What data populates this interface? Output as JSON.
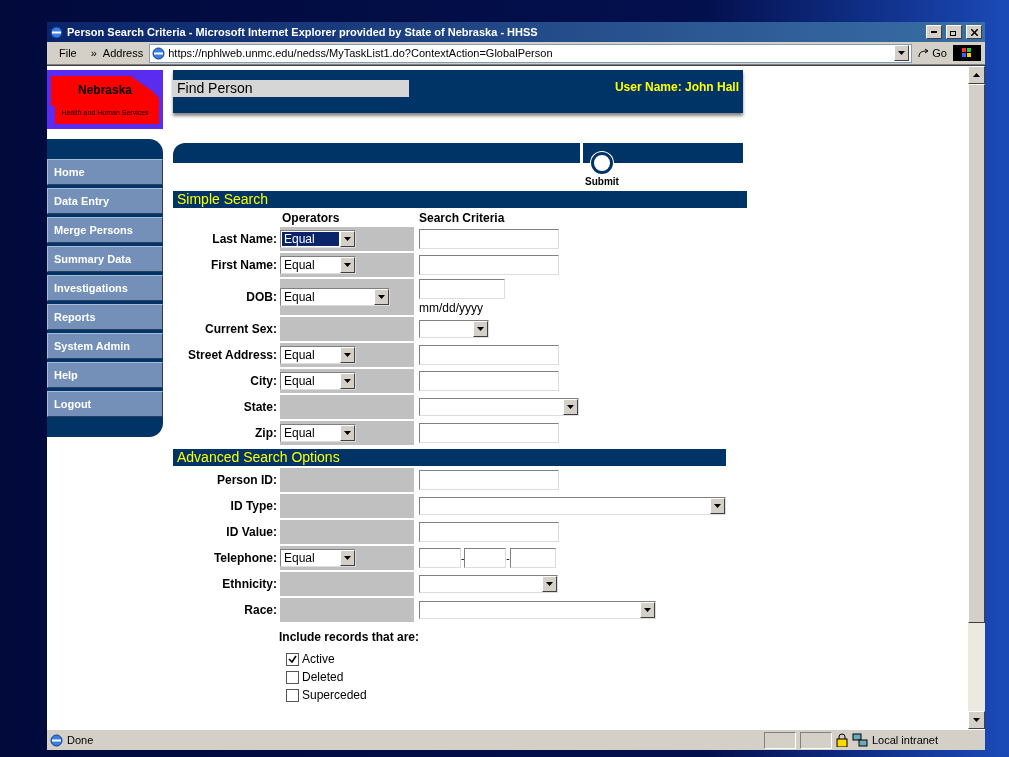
{
  "window": {
    "title": "Person Search Criteria - Microsoft Internet Explorer provided by State of Nebraska - HHSS"
  },
  "toolbar": {
    "menu": "File",
    "chevron": "»",
    "address_label": "Address",
    "url": "https://nphlweb.unmc.edu/nedss/MyTaskList1.do?ContextAction=GlobalPerson",
    "go": "Go"
  },
  "logo": {
    "title": "Nebraska",
    "subtitle": "Health and Human Services"
  },
  "sidebar": {
    "items": [
      {
        "label": "Home"
      },
      {
        "label": "Data Entry"
      },
      {
        "label": "Merge Persons"
      },
      {
        "label": "Summary Data"
      },
      {
        "label": "Investigations"
      },
      {
        "label": "Reports"
      },
      {
        "label": "System Admin"
      },
      {
        "label": "Help"
      },
      {
        "label": "Logout"
      }
    ]
  },
  "header": {
    "title": "Find Person",
    "user": "User Name: John Hall"
  },
  "submit": {
    "label": "Submit"
  },
  "simple_search": {
    "title": "Simple Search",
    "col_operators": "Operators",
    "col_criteria": "Search Criteria",
    "rows": [
      {
        "label": "Last Name:",
        "operator": {
          "value": "Equal",
          "focused": true
        },
        "kind": "text"
      },
      {
        "label": "First Name:",
        "operator": {
          "value": "Equal",
          "focused": false
        },
        "kind": "text"
      },
      {
        "label": "DOB:",
        "operator": {
          "value": "Equal",
          "focused": false
        },
        "kind": "date",
        "hint": "mm/dd/yyyy"
      },
      {
        "label": "Current Sex:",
        "kind": "select-small"
      },
      {
        "label": "Street Address:",
        "operator": {
          "value": "Equal",
          "focused": false
        },
        "kind": "text"
      },
      {
        "label": "City:",
        "operator": {
          "value": "Equal",
          "focused": false
        },
        "kind": "text"
      },
      {
        "label": "State:",
        "kind": "select-medium"
      },
      {
        "label": "Zip:",
        "operator": {
          "value": "Equal",
          "focused": false
        },
        "kind": "text"
      }
    ]
  },
  "advanced_search": {
    "title": "Advanced Search Options",
    "rows": [
      {
        "label": "Person ID:",
        "kind": "text"
      },
      {
        "label": "ID Type:",
        "kind": "select-wide"
      },
      {
        "label": "ID Value:",
        "kind": "text"
      },
      {
        "label": "Telephone:",
        "operator": {
          "value": "Equal",
          "focused": false
        },
        "kind": "phone",
        "separator": "-"
      },
      {
        "label": "Ethnicity:",
        "kind": "select-ethnicity"
      },
      {
        "label": "Race:",
        "kind": "select-race"
      }
    ],
    "include_label": "Include records that are:",
    "options": [
      {
        "label": "Active",
        "checked": true
      },
      {
        "label": "Deleted",
        "checked": false
      },
      {
        "label": "Superceded",
        "checked": false
      }
    ]
  },
  "status_bar": {
    "text": "Done",
    "zone": "Local intranet"
  }
}
